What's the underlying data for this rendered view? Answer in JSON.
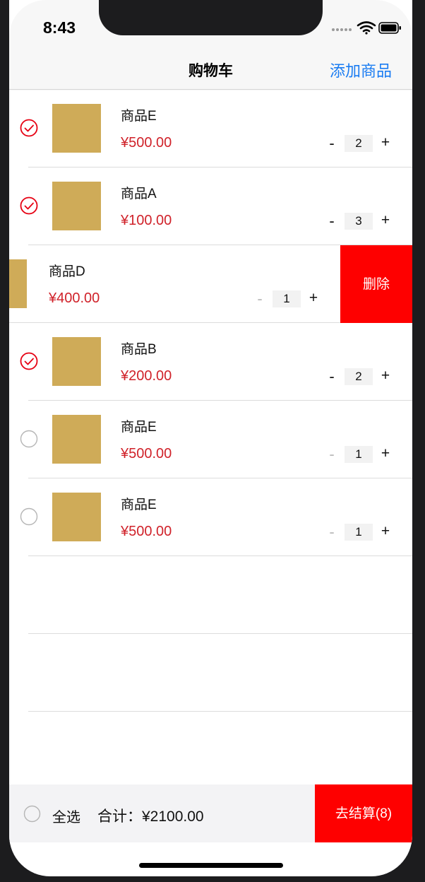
{
  "status_bar": {
    "time": "8:43"
  },
  "nav": {
    "title": "购物车",
    "add_label": "添加商品"
  },
  "cart_items": [
    {
      "name": "商品E",
      "price": "¥500.00",
      "quantity": "2",
      "selected": true
    },
    {
      "name": "商品A",
      "price": "¥100.00",
      "quantity": "3",
      "selected": true
    },
    {
      "name": "商品D",
      "price": "¥400.00",
      "quantity": "1",
      "selected": false,
      "swiped_open": true
    },
    {
      "name": "商品B",
      "price": "¥200.00",
      "quantity": "2",
      "selected": true
    },
    {
      "name": "商品E",
      "price": "¥500.00",
      "quantity": "1",
      "selected": false
    },
    {
      "name": "商品E",
      "price": "¥500.00",
      "quantity": "1",
      "selected": false
    }
  ],
  "row_controls": {
    "minus": "-",
    "plus": "+",
    "delete_label": "删除"
  },
  "footer": {
    "select_all_label": "全选",
    "select_all_checked": false,
    "total_text": "合计：¥2100.00",
    "checkout_label": "去结算(8)"
  },
  "colors": {
    "accent_red": "#fe0000",
    "price_red": "#d0222a",
    "link_blue": "#1a7cf2",
    "thumb_gold": "#cfab58"
  },
  "icons": [
    "checkmark-circle-icon",
    "empty-circle-icon",
    "wifi-icon",
    "battery-icon",
    "signal-dots-icon"
  ]
}
